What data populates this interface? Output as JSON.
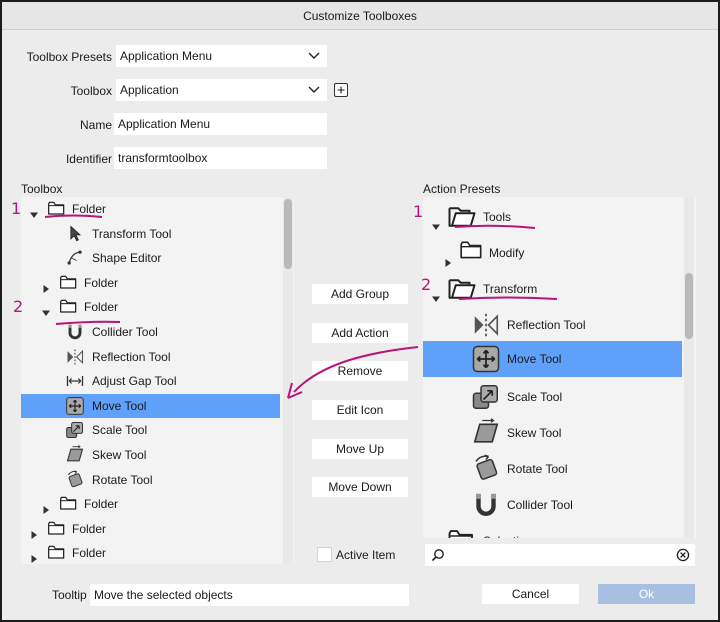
{
  "window": {
    "title": "Customize Toolboxes"
  },
  "form": {
    "presets_label": "Toolbox Presets",
    "presets_value": "Application Menu",
    "toolbox_label": "Toolbox",
    "toolbox_value": "Application",
    "name_label": "Name",
    "name_value": "Application Menu",
    "identifier_label": "Identifier",
    "identifier_value": "transformtoolbox"
  },
  "left_panel": {
    "title": "Toolbox",
    "rows": [
      {
        "label": "Folder",
        "icon": "folder-icon",
        "expander": "expanded"
      },
      {
        "label": "Transform Tool",
        "icon": "cursor-arrow-icon"
      },
      {
        "label": "Shape Editor",
        "icon": "shape-editor-icon"
      },
      {
        "label": "Folder",
        "icon": "folder-icon",
        "expander": "collapsed"
      },
      {
        "label": "Folder",
        "icon": "folder-icon",
        "expander": "expanded"
      },
      {
        "label": "Collider Tool",
        "icon": "magnet-icon"
      },
      {
        "label": "Reflection Tool",
        "icon": "reflection-icon"
      },
      {
        "label": "Adjust Gap Tool",
        "icon": "adjust-gap-icon"
      },
      {
        "label": "Move Tool",
        "icon": "move-icon",
        "selected": true
      },
      {
        "label": "Scale Tool",
        "icon": "scale-icon"
      },
      {
        "label": "Skew Tool",
        "icon": "skew-icon"
      },
      {
        "label": "Rotate Tool",
        "icon": "rotate-icon"
      },
      {
        "label": "Folder",
        "icon": "folder-icon",
        "expander": "collapsed"
      },
      {
        "label": "Folder",
        "icon": "folder-icon",
        "expander": "collapsed"
      },
      {
        "label": "Folder",
        "icon": "folder-icon",
        "expander": "collapsed"
      }
    ]
  },
  "right_panel": {
    "title": "Action Presets",
    "rows": [
      {
        "label": "Tools",
        "icon": "folder-open-icon",
        "expander": "expanded"
      },
      {
        "label": "Modify",
        "icon": "folder-icon",
        "expander": "collapsed"
      },
      {
        "label": "Transform",
        "icon": "folder-open-icon",
        "expander": "expanded"
      },
      {
        "label": "Reflection Tool",
        "icon": "reflection-icon"
      },
      {
        "label": "Move Tool",
        "icon": "move-icon",
        "selected": true
      },
      {
        "label": "Scale Tool",
        "icon": "scale-icon"
      },
      {
        "label": "Skew Tool",
        "icon": "skew-icon"
      },
      {
        "label": "Rotate Tool",
        "icon": "rotate-icon"
      },
      {
        "label": "Collider Tool",
        "icon": "magnet-icon"
      },
      {
        "label": "Selection",
        "icon": "folder-icon",
        "expander": "collapsed"
      }
    ]
  },
  "actions": {
    "add_group": "Add Group",
    "add_action": "Add Action",
    "remove": "Remove",
    "edit_icon": "Edit Icon",
    "move_up": "Move Up",
    "move_down": "Move Down"
  },
  "active_item": {
    "label": "Active Item",
    "checked": false
  },
  "search": {
    "placeholder": "",
    "value": ""
  },
  "tooltip": {
    "label": "Tooltip",
    "value": "Move the selected objects"
  },
  "footer": {
    "cancel": "Cancel",
    "ok": "Ok"
  },
  "annotations": {
    "numerals": [
      "1",
      "2",
      "1",
      "2"
    ],
    "color": "#b8147a"
  },
  "colors": {
    "selection": "#5fa0fb",
    "ok_button": "#a9bfe2",
    "annotation": "#b8147a"
  }
}
